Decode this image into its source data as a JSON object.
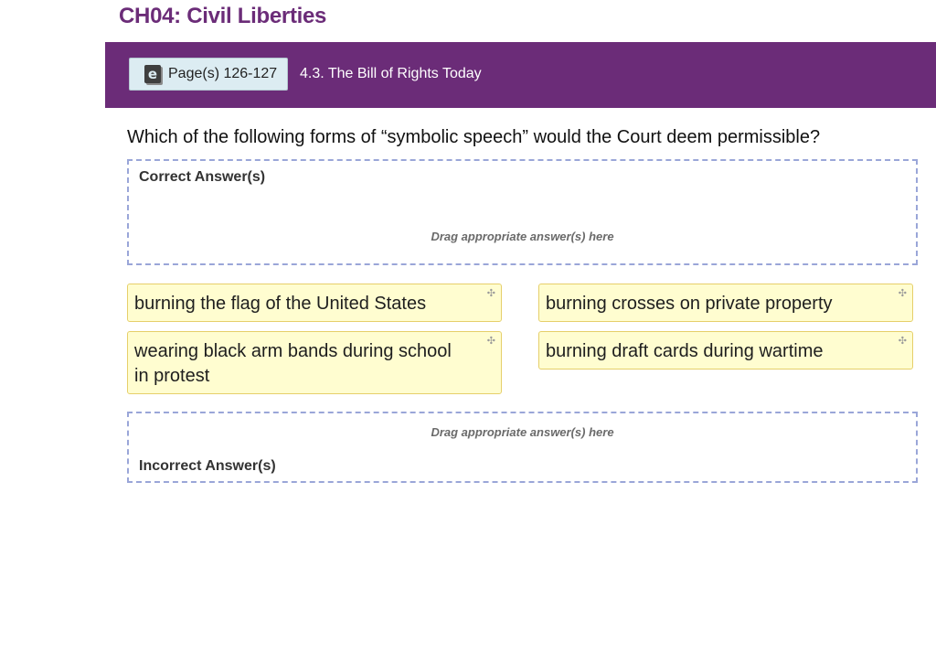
{
  "chapter": {
    "title": "CH04: Civil Liberties"
  },
  "banner": {
    "pages_button": {
      "icon": "ebook-icon",
      "icon_glyph": "e",
      "label": "Page(s) 126-127"
    },
    "section": "4.3. The Bill of Rights Today",
    "background_color": "#6b2c78"
  },
  "question": {
    "text": "Which of the following forms of “symbolic speech” would the Court deem permissible?"
  },
  "correct_zone": {
    "label": "Correct Answer(s)",
    "hint": "Drag appropriate answer(s) here"
  },
  "incorrect_zone": {
    "label": "Incorrect Answer(s)",
    "hint": "Drag appropriate answer(s) here"
  },
  "answers": [
    {
      "text": "burning the flag of the United States",
      "icon": "move-icon",
      "icon_glyph": "✣"
    },
    {
      "text": "burning crosses on private property",
      "icon": "move-icon",
      "icon_glyph": "✣"
    },
    {
      "text": "wearing black arm bands during school in protest",
      "icon": "move-icon",
      "icon_glyph": "✣"
    },
    {
      "text": "burning draft cards during wartime",
      "icon": "move-icon",
      "icon_glyph": "✣"
    }
  ],
  "colors": {
    "card_background": "#fffdd0",
    "card_border": "#e6cf6a",
    "dropzone_border": "#9aa6d8",
    "title": "#6b2c78"
  }
}
